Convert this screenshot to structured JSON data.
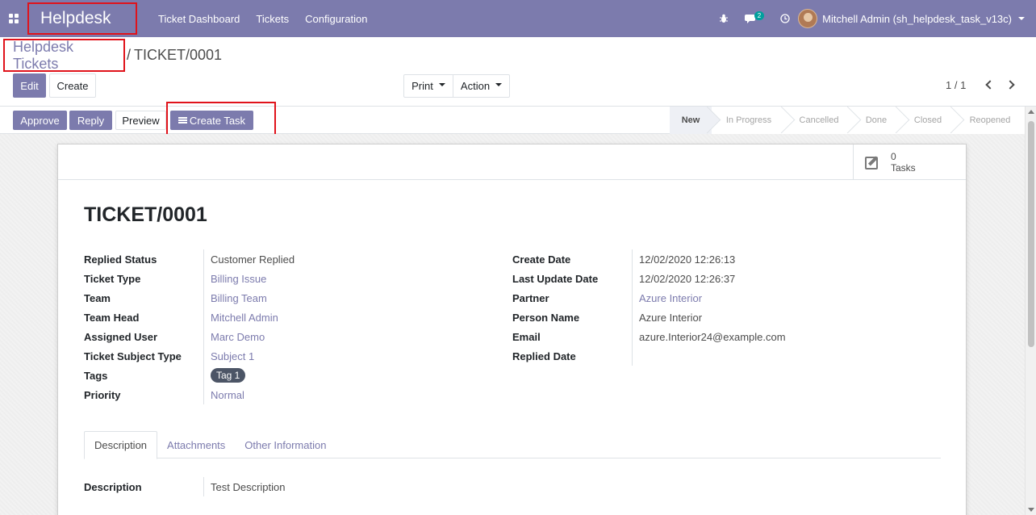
{
  "navbar": {
    "app_name": "Helpdesk",
    "menu": [
      "Ticket Dashboard",
      "Tickets",
      "Configuration"
    ],
    "chat_count": "2",
    "user": "Mitchell Admin (sh_helpdesk_task_v13c)",
    "bg_color": "#7c7bad"
  },
  "breadcrumb": {
    "parent": "Helpdesk Tickets",
    "separator": "/",
    "current": "TICKET/0001"
  },
  "control": {
    "edit": "Edit",
    "create": "Create",
    "print": "Print",
    "action": "Action",
    "pager": "1 / 1"
  },
  "statusbar": {
    "approve": "Approve",
    "reply": "Reply",
    "preview": "Preview",
    "create_task": "Create Task",
    "stages": [
      "New",
      "In Progress",
      "Cancelled",
      "Done",
      "Closed",
      "Reopened"
    ],
    "active_stage": "New"
  },
  "smart_button": {
    "count": "0",
    "label": "Tasks"
  },
  "ticket": {
    "title": "TICKET/0001",
    "left": [
      {
        "label": "Replied Status",
        "value": "Customer Replied",
        "link": false
      },
      {
        "label": "Ticket Type",
        "value": "Billing Issue",
        "link": true
      },
      {
        "label": "Team",
        "value": "Billing Team",
        "link": true
      },
      {
        "label": "Team Head",
        "value": "Mitchell Admin",
        "link": true
      },
      {
        "label": "Assigned User",
        "value": "Marc Demo",
        "link": true
      },
      {
        "label": "Ticket Subject Type",
        "value": "Subject 1",
        "link": true
      },
      {
        "label": "Tags",
        "value": "Tag 1",
        "tag": true
      },
      {
        "label": "Priority",
        "value": "Normal",
        "link": true
      }
    ],
    "right": [
      {
        "label": "Create Date",
        "value": "12/02/2020 12:26:13",
        "link": false
      },
      {
        "label": "Last Update Date",
        "value": "12/02/2020 12:26:37",
        "link": false
      },
      {
        "label": "Partner",
        "value": "Azure Interior",
        "link": true
      },
      {
        "label": "Person Name",
        "value": "Azure Interior",
        "link": false
      },
      {
        "label": "Email",
        "value": "azure.Interior24@example.com",
        "link": false
      },
      {
        "label": "Replied Date",
        "value": "",
        "link": false
      }
    ]
  },
  "tabs": [
    "Description",
    "Attachments",
    "Other Information"
  ],
  "description": {
    "label": "Description",
    "value": "Test Description"
  }
}
